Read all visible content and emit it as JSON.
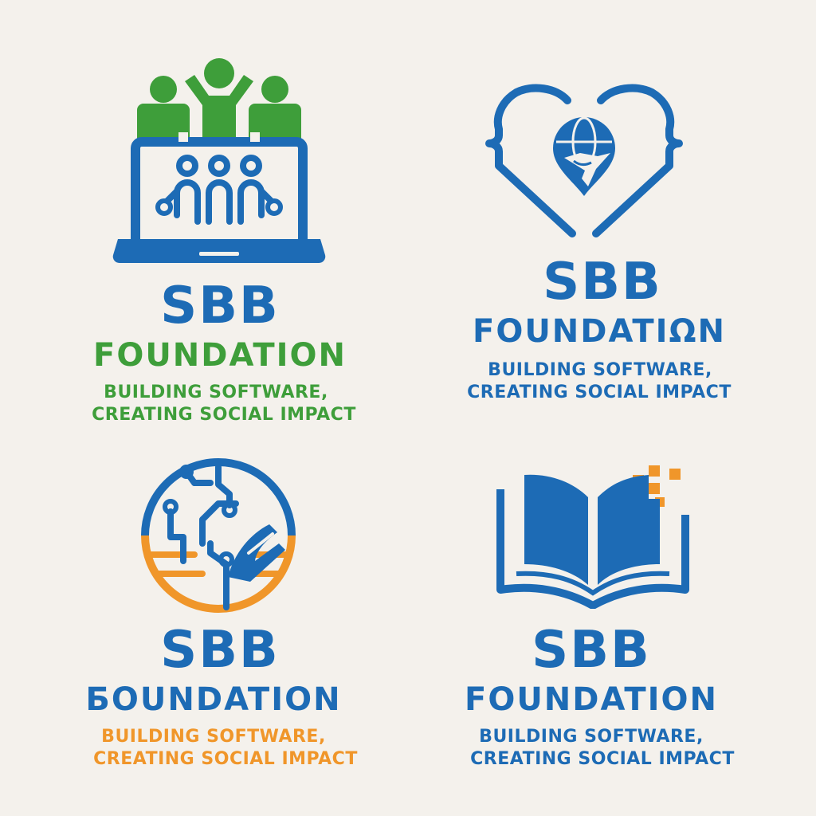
{
  "colors": {
    "blue": "#1d6bb5",
    "green": "#3e9e3a",
    "orange": "#f0962a",
    "background": "#f4f1ec"
  },
  "logos": [
    {
      "icon": "laptop-people-icon",
      "name": "SBB",
      "subtitle": "FOUNDATION",
      "tagline_1": "BUILDING SOFTWARE,",
      "tagline_2": "CREATING SOCIAL IMPACT",
      "name_color": "#1d6bb5",
      "subtitle_color": "#3e9e3a",
      "tagline_color": "#3e9e3a"
    },
    {
      "icon": "heart-globe-icon",
      "name": "SBB",
      "subtitle": "FOUNDATIΩN",
      "tagline_1": "BUILDING SOFTWARE,",
      "tagline_2": "CREATING SOCIAL IMPACT",
      "name_color": "#1d6bb5",
      "subtitle_color": "#1d6bb5",
      "tagline_color": "#1d6bb5"
    },
    {
      "icon": "circuit-globe-icon",
      "name": "SBB",
      "subtitle": "БOUNDATION",
      "tagline_1": "BUILDING SOFTWARE,",
      "tagline_2": "CREATING SOCIAL IMPACT",
      "name_color": "#1d6bb5",
      "subtitle_color": "#1d6bb5",
      "tagline_color": "#f0962a"
    },
    {
      "icon": "open-book-icon",
      "name": "SBB",
      "subtitle": "FOUNDATION",
      "tagline_1": "BUILDING SOFTWARE,",
      "tagline_2": "CREATING SOCIAL IMPACT",
      "name_color": "#1d6bb5",
      "subtitle_color": "#1d6bb5",
      "tagline_color": "#1d6bb5"
    }
  ]
}
